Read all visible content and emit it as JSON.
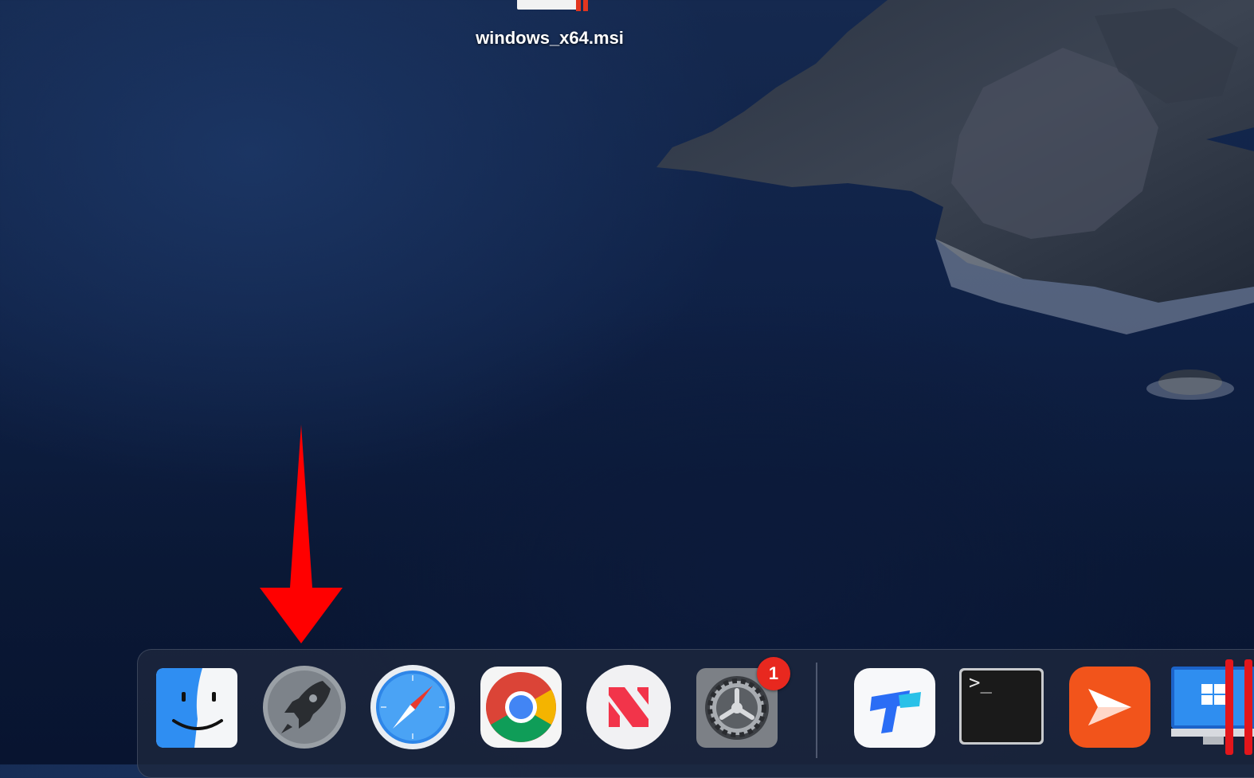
{
  "desktop": {
    "file_name": "windows_x64.msi"
  },
  "dock": {
    "apps": [
      {
        "name": "Finder",
        "icon": "finder-icon"
      },
      {
        "name": "Launchpad",
        "icon": "launchpad-rocket-icon"
      },
      {
        "name": "Safari",
        "icon": "safari-compass-icon"
      },
      {
        "name": "Google Chrome",
        "icon": "chrome-icon"
      },
      {
        "name": "News",
        "icon": "news-icon"
      },
      {
        "name": "System Preferences",
        "icon": "gear-icon",
        "badge": "1"
      },
      {
        "name": "ToDesk",
        "icon": "todesk-icon"
      },
      {
        "name": "Terminal",
        "icon": "terminal-icon",
        "prompt": ">_"
      },
      {
        "name": "Infuse",
        "icon": "infuse-icon"
      },
      {
        "name": "Windows Desktop",
        "icon": "windows-monitor-icon"
      }
    ],
    "system_preferences_badge": "1",
    "terminal_prompt": ">_"
  },
  "annotation": {
    "arrow_color": "#ff0000",
    "marker_color": "#e3161b"
  }
}
